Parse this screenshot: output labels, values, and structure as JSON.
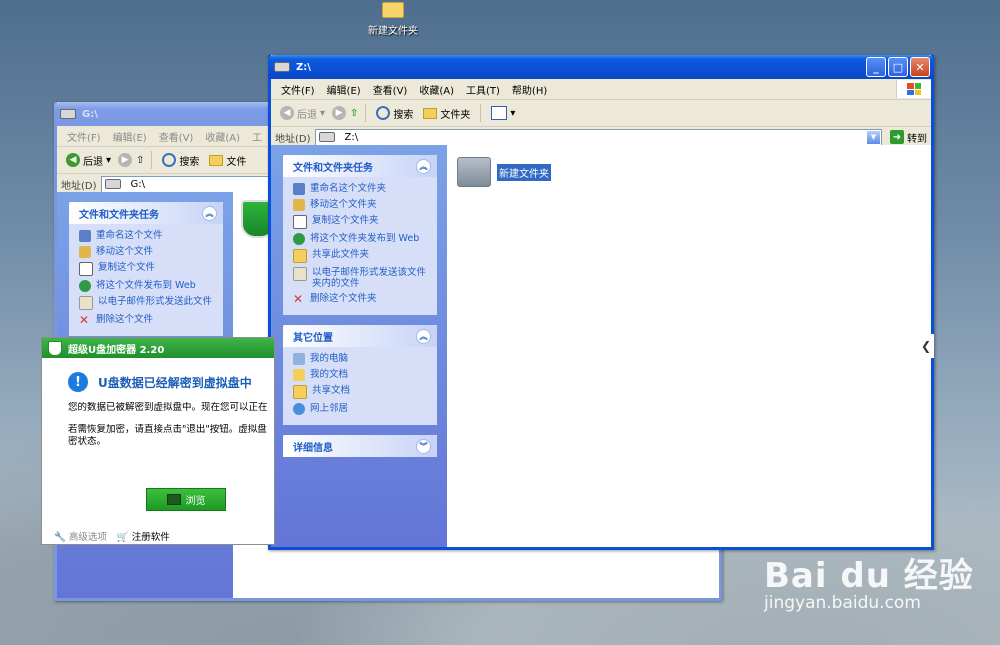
{
  "desktop": {
    "icon_label": "新建文件夹"
  },
  "window_z": {
    "title": "Z:\\",
    "menu": [
      "文件(F)",
      "编辑(E)",
      "查看(V)",
      "收藏(A)",
      "工具(T)",
      "帮助(H)"
    ],
    "toolbar": {
      "back": "后退",
      "search": "搜索",
      "folders": "文件夹"
    },
    "address_label": "地址(D)",
    "address_value": "Z:\\",
    "go_label": "转到",
    "tasks_title": "文件和文件夹任务",
    "tasks": [
      "重命名这个文件夹",
      "移动这个文件夹",
      "复制这个文件夹",
      "将这个文件夹发布到 Web",
      "共享此文件夹",
      "以电子邮件形式发送该文件夹内的文件",
      "删除这个文件夹"
    ],
    "other_title": "其它位置",
    "other_places": [
      "我的电脑",
      "我的文档",
      "共享文档",
      "网上邻居"
    ],
    "details_title": "详细信息",
    "folder_item": "新建文件夹"
  },
  "window_g": {
    "title": "G:\\",
    "menu": [
      "文件(F)",
      "编辑(E)",
      "查看(V)",
      "收藏(A)",
      "工"
    ],
    "toolbar": {
      "back": "后退",
      "search": "搜索",
      "folders": "文件"
    },
    "address_label": "地址(D)",
    "address_value": "G:\\",
    "tasks_title": "文件和文件夹任务",
    "tasks": [
      "重命名这个文件",
      "移动这个文件",
      "复制这个文件",
      "将这个文件发布到 Web",
      "以电子邮件形式发送此文件",
      "删除这个文件"
    ]
  },
  "dialog": {
    "title": "超级U盘加密器 2.20",
    "heading": "U盘数据已经解密到虚拟盘中",
    "line1": "您的数据已被解密到虚拟盘中。现在您可以正在",
    "line2": "若需恢复加密，请直接点击\"退出\"按钮。虚拟盘",
    "line3": "密状态。",
    "browse_label": "浏览",
    "advanced_label": "高级选项",
    "register_label": "注册软件"
  },
  "watermark": {
    "logo": "Bai du 经验",
    "url": "jingyan.baidu.com"
  }
}
